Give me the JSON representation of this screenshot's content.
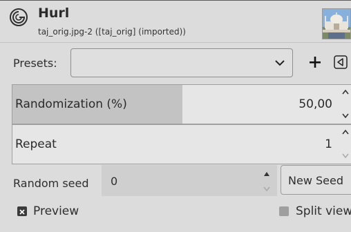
{
  "header": {
    "title": "Hurl",
    "subtitle": "taj_orig.jpg-2 ([taj_orig] (imported))",
    "logo_icon": "gimp-hurl-icon",
    "thumbnail_icon": "taj-mahal-thumbnail"
  },
  "presets": {
    "label": "Presets:",
    "value": "",
    "add_icon": "plus-icon",
    "menu_icon": "menu-triangle-icon"
  },
  "randomization": {
    "label": "Randomization (%)",
    "value": "50,00",
    "fraction": 0.5
  },
  "repeat": {
    "label": "Repeat",
    "value": "1",
    "fraction": 0.0
  },
  "seed": {
    "label": "Random seed",
    "value": "0",
    "button": "New Seed"
  },
  "preview": {
    "label": "Preview",
    "checked": true
  },
  "split_view": {
    "label": "Split view",
    "checked": false
  },
  "colors": {
    "background": "#dcdcdc",
    "fill": "#c3c3c3"
  }
}
